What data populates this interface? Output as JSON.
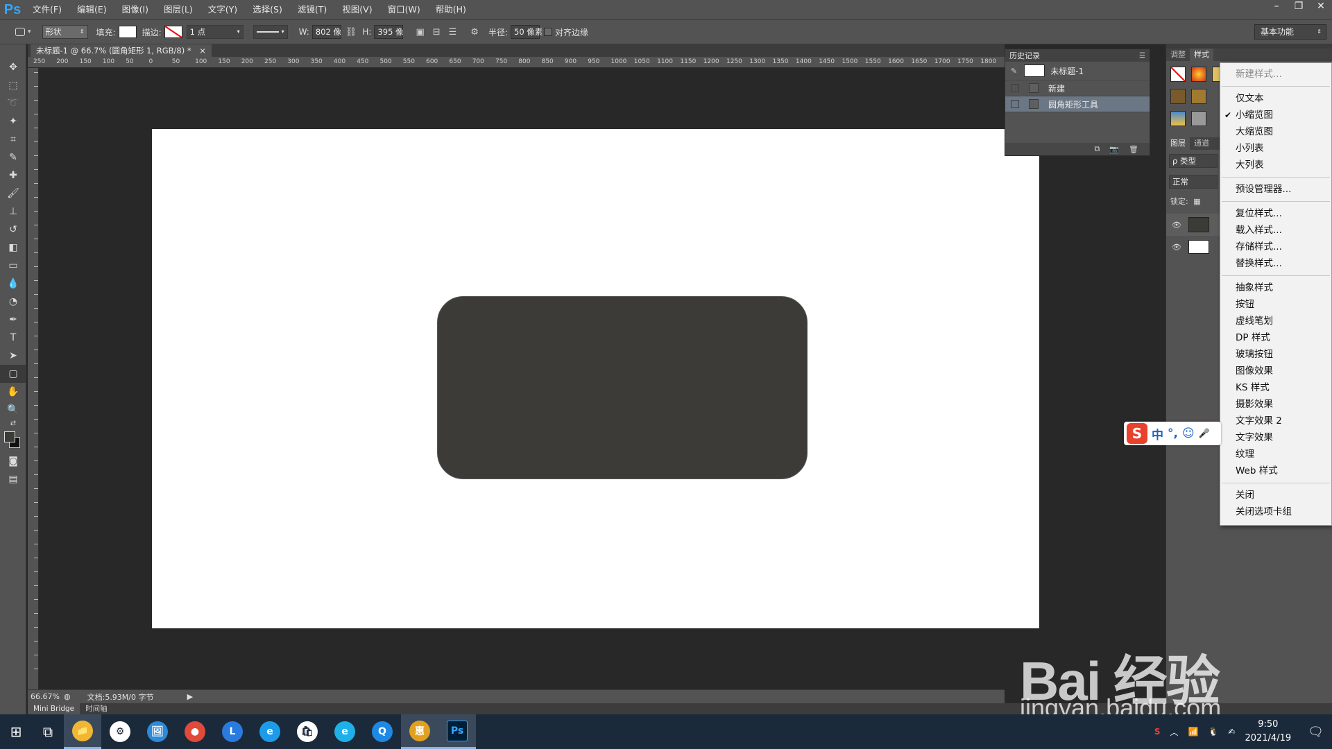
{
  "app": {
    "logo": "Ps",
    "menus": [
      "文件(F)",
      "编辑(E)",
      "图像(I)",
      "图层(L)",
      "文字(Y)",
      "选择(S)",
      "滤镜(T)",
      "视图(V)",
      "窗口(W)",
      "帮助(H)"
    ],
    "window_controls": [
      "–",
      "❐",
      "✕"
    ]
  },
  "options": {
    "mode": "形状",
    "fill_label": "填充:",
    "stroke_label": "描边:",
    "stroke_width": "1 点",
    "w_label": "W:",
    "w_value": "802 像",
    "h_label": "H:",
    "h_value": "395 像",
    "radius_label": "半径:",
    "radius_value": "50 像素",
    "align_edges": "对齐边缘",
    "workspace": "基本功能"
  },
  "document": {
    "tab_title": "未标题-1 @ 66.7% (圆角矩形 1, RGB/8) *",
    "tab_close": "×",
    "ruler_ticks": [
      "250",
      "200",
      "150",
      "100",
      "50",
      "0",
      "50",
      "100",
      "150",
      "200",
      "250",
      "300",
      "350",
      "400",
      "450",
      "500",
      "550",
      "600",
      "650",
      "700",
      "750",
      "800",
      "850",
      "900",
      "950",
      "1000",
      "1050",
      "1100",
      "1150",
      "1200",
      "1250",
      "1300",
      "1350",
      "1400",
      "1450",
      "1500",
      "1550",
      "1600",
      "1650",
      "1700",
      "1750",
      "1800"
    ],
    "shape_color": "#3c3b37"
  },
  "status": {
    "zoom": "66.67%",
    "doc_info": "文档:5.93M/0 字节"
  },
  "bottom_tabs": [
    "Mini Bridge",
    "时间轴"
  ],
  "history": {
    "tab": "历史记录",
    "rows": [
      {
        "label": "未标题-1",
        "kind": "snapshot"
      },
      {
        "label": "新建",
        "kind": "step"
      },
      {
        "label": "圆角矩形工具",
        "kind": "step",
        "selected": true
      }
    ]
  },
  "right_dock": {
    "top_tabs": [
      "调整",
      "样式"
    ],
    "layer_tabs": [
      "图层",
      "通道"
    ],
    "filter_type": "ρ 类型",
    "blend_mode": "正常",
    "lock_label": "锁定:"
  },
  "flyout": {
    "items": [
      {
        "label": "新建样式...",
        "disabled": true
      },
      {
        "sep": true
      },
      {
        "label": "仅文本"
      },
      {
        "label": "小缩览图",
        "checked": true
      },
      {
        "label": "大缩览图"
      },
      {
        "label": "小列表"
      },
      {
        "label": "大列表"
      },
      {
        "sep": true
      },
      {
        "label": "预设管理器..."
      },
      {
        "sep": true
      },
      {
        "label": "复位样式..."
      },
      {
        "label": "载入样式..."
      },
      {
        "label": "存储样式..."
      },
      {
        "label": "替换样式..."
      },
      {
        "sep": true
      },
      {
        "label": "抽象样式"
      },
      {
        "label": "按钮"
      },
      {
        "label": "虚线笔划"
      },
      {
        "label": "DP 样式"
      },
      {
        "label": "玻璃按钮"
      },
      {
        "label": "图像效果"
      },
      {
        "label": "KS 样式"
      },
      {
        "label": "摄影效果"
      },
      {
        "label": "文字效果 2"
      },
      {
        "label": "文字效果"
      },
      {
        "label": "纹理"
      },
      {
        "label": "Web 样式"
      },
      {
        "sep": true
      },
      {
        "label": "关闭"
      },
      {
        "label": "关闭选项卡组"
      }
    ]
  },
  "ime": {
    "logo": "S",
    "items": [
      "中",
      "°,",
      "☺",
      "🎤"
    ]
  },
  "watermark": {
    "main": "Bai 经验",
    "sub": "jingyan.baidu.com"
  },
  "taskbar": {
    "clock_time": "9:50",
    "clock_date": "2021/4/19",
    "apps": [
      {
        "name": "windows-start",
        "glyph": "⊞"
      },
      {
        "name": "task-view",
        "glyph": "⧉"
      },
      {
        "name": "file-explorer",
        "glyph": "📁"
      },
      {
        "name": "settings",
        "glyph": "⚙"
      },
      {
        "name": "photos",
        "glyph": "🖼"
      },
      {
        "name": "chrome",
        "glyph": "●"
      },
      {
        "name": "l-app",
        "glyph": "L"
      },
      {
        "name": "ie",
        "glyph": "e"
      },
      {
        "name": "store",
        "glyph": "🛍"
      },
      {
        "name": "edge-like",
        "glyph": "e"
      },
      {
        "name": "q-browser",
        "glyph": "Q"
      },
      {
        "name": "hui",
        "glyph": "惠"
      },
      {
        "name": "photoshop",
        "glyph": "Ps"
      }
    ]
  }
}
